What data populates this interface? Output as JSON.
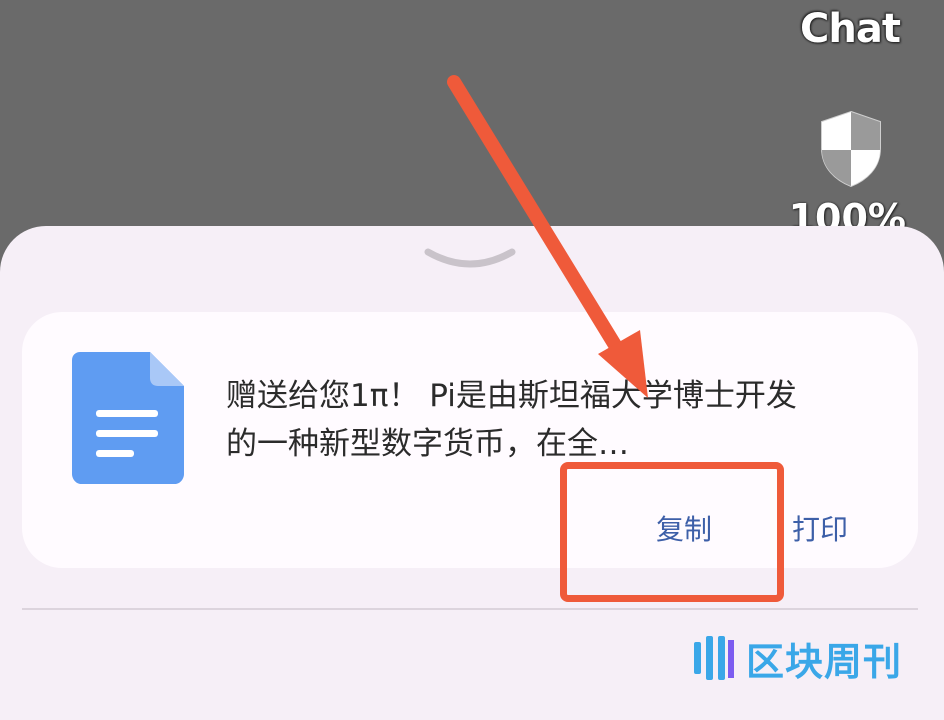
{
  "status_bar": {
    "app_label": "Chat",
    "battery": "100%",
    "shield_icon": "shield-icon"
  },
  "share_sheet": {
    "collapse_icon": "chevron-down-icon",
    "document_icon": "document-icon",
    "preview_text": "赠送给您1π！ Pi是由斯坦福大学博士开发的一种新型数字货币，在全…",
    "actions": {
      "copy": "复制",
      "print": "打印"
    }
  },
  "annotation": {
    "arrow_color": "#ef5a3a",
    "highlight_color": "#ef5a3a"
  },
  "watermark": {
    "text": "区块周刊",
    "color": "#3aa7e8"
  }
}
